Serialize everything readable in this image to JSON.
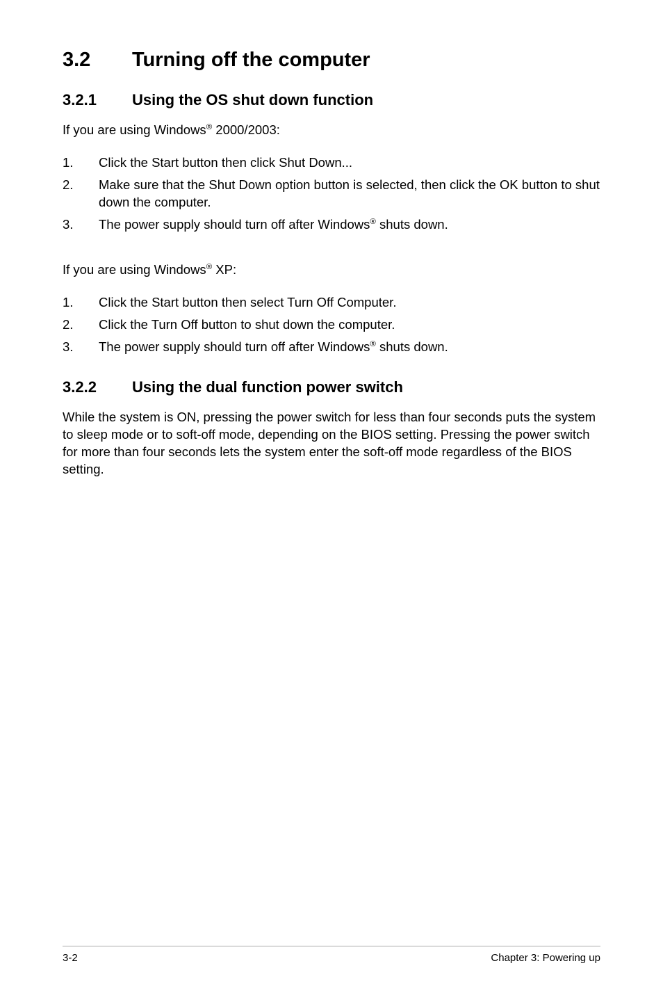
{
  "section": {
    "number": "3.2",
    "title": "Turning off the computer"
  },
  "sub1": {
    "number": "3.2.1",
    "title": "Using the OS shut down function",
    "intro_a_prefix": "If you are using Windows",
    "intro_a_suffix": " 2000/2003:",
    "steps_a": [
      {
        "n": "1.",
        "t": "Click the Start button then click Shut Down..."
      },
      {
        "n": "2.",
        "t": "Make sure that the Shut Down option button is selected, then click the OK button to shut down the computer."
      },
      {
        "n": "3.",
        "t_prefix": "The power supply should turn off after Windows",
        "t_suffix": " shuts down."
      }
    ],
    "intro_b_prefix": "If you are using Windows",
    "intro_b_suffix": " XP:",
    "steps_b": [
      {
        "n": "1.",
        "t": "Click the Start button then select Turn Off Computer."
      },
      {
        "n": "2.",
        "t": "Click the Turn Off button to shut down the computer."
      },
      {
        "n": "3.",
        "t_prefix": "The power supply should turn off after Windows",
        "t_suffix": " shuts down."
      }
    ]
  },
  "sub2": {
    "number": "3.2.2",
    "title": "Using the dual function power switch",
    "body": "While the system is ON, pressing the power switch for less than four seconds puts the system to sleep mode or to soft-off mode, depending on the BIOS setting. Pressing the power switch for more than four seconds lets the system enter the soft-off mode regardless of the BIOS setting."
  },
  "footer": {
    "page": "3-2",
    "chapter": "Chapter 3: Powering up"
  },
  "reg_mark": "®"
}
